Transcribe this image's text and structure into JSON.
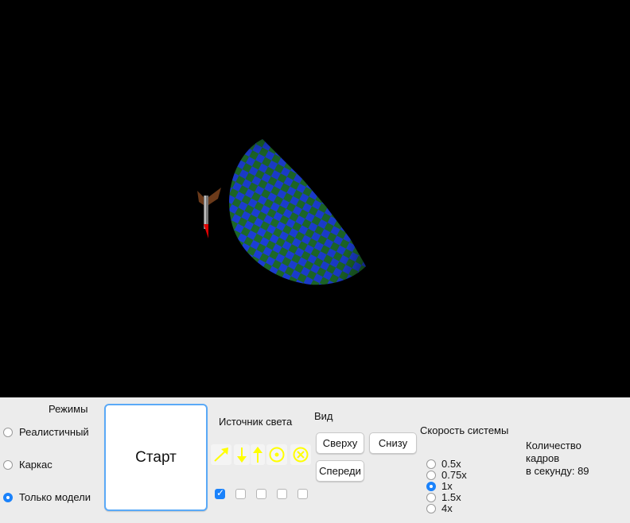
{
  "modes": {
    "title": "Режимы",
    "options": [
      "Реалистичный",
      "Каркас",
      "Только модели"
    ],
    "selected_index": 2
  },
  "start_button": "Старт",
  "light_source": {
    "title": "Источник света",
    "icons": [
      "arrow-diagonal-icon",
      "arrow-down-icon",
      "arrow-up-icon",
      "target-dot-icon",
      "target-cross-icon"
    ],
    "checkboxes": [
      true,
      false,
      false,
      false,
      false
    ],
    "icon_color": "#ffff00"
  },
  "view": {
    "title": "Вид",
    "top": "Сверху",
    "bottom": "Снизу",
    "front": "Спереди"
  },
  "speed": {
    "title": "Скорость системы",
    "options": [
      "0.5x",
      "0.75x",
      "1x",
      "1.5x",
      "4x"
    ],
    "selected_index": 2
  },
  "fps": {
    "line1": "Количество",
    "line2": "кадров",
    "line3": "в секунду: 89"
  },
  "scene": {
    "background": "#000000",
    "checker_colors": [
      "#1c3fd8",
      "#1e6b2a"
    ]
  }
}
